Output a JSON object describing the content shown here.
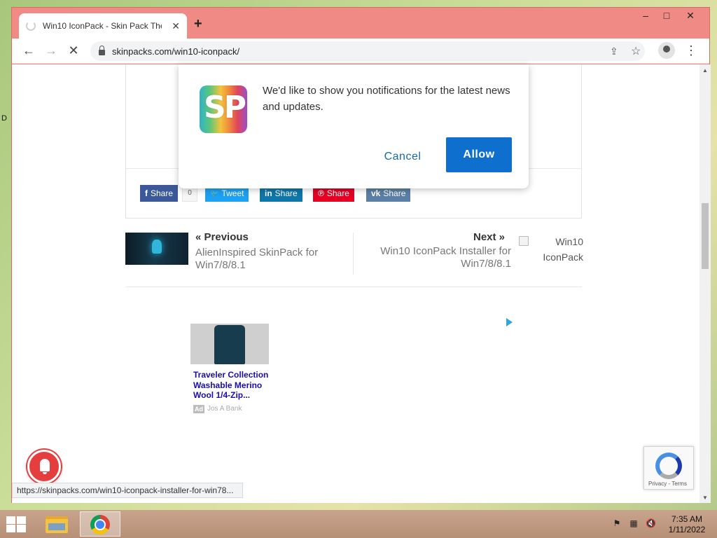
{
  "browser": {
    "tab_title": "Win10 IconPack - Skin Pack Theme",
    "new_tab_symbol": "+",
    "url": "skinpacks.com/win10-iconpack/",
    "window_controls": {
      "minimize": "‒",
      "maximize": "□",
      "close": "✕"
    },
    "nav": {
      "back": "←",
      "forward": "→",
      "stop": "✕",
      "menu": "⋮",
      "share": "⇪",
      "star": "☆"
    },
    "status_url": "https://skinpacks.com/win10-iconpack-installer-for-win78..."
  },
  "notification_prompt": {
    "logo_text": "SP",
    "message": "We'd like to show you notifications for the latest news and updates.",
    "cancel_label": "Cancel",
    "allow_label": "Allow",
    "accent_color": "#0f6fcf"
  },
  "share_bar": {
    "buttons": [
      {
        "icon": "f",
        "label": "Share",
        "color": "#3b5998"
      },
      {
        "icon": "🐦",
        "label": "Tweet",
        "color": "#1da1f2"
      },
      {
        "icon": "in",
        "label": "Share",
        "color": "#0e76a8"
      },
      {
        "icon": "℗",
        "label": "Share",
        "color": "#e60023"
      },
      {
        "icon": "vk",
        "label": "Share",
        "color": "#5b7fa6"
      }
    ],
    "facebook_count": "0"
  },
  "post_nav": {
    "previous_label": "Previous",
    "previous_title": "AlienInspired SkinPack for Win7/8/8.1",
    "next_label": "Next",
    "next_title": "Win10 IconPack Installer for Win7/8/8.1",
    "next_image_alt": "Win10 IconPack"
  },
  "ad": {
    "title": "Traveler Collection Washable Merino Wool 1/4-Zip...",
    "badge": "Ad",
    "source": "Jos A Bank"
  },
  "recaptcha": {
    "text": "Privacy - Terms"
  },
  "taskbar": {
    "time": "7:35 AM",
    "date": "1/11/2022"
  }
}
